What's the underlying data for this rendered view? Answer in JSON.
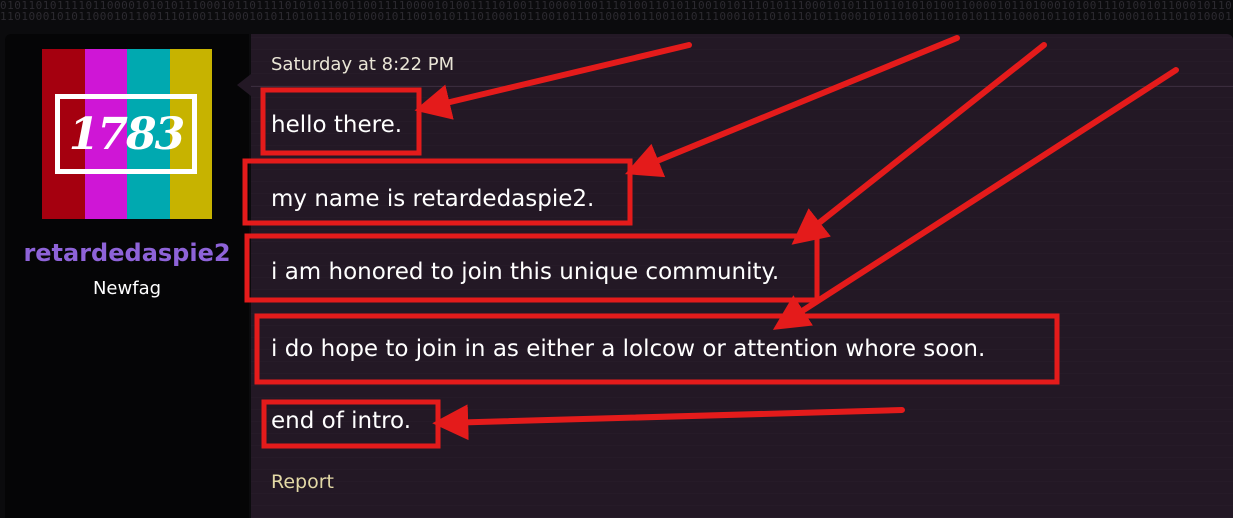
{
  "header": {
    "binary_rows": [
      "0101101011110110000101010111000101101111010101100110011110000101001111010011100001001110100110101100101011101011100010101110110101010011000010110100010100111010010110001011011010011101010101110101",
      "1101000101011000101100111010011100010101101011101010001011001010111010001011001011101000101100101011100010110101101011000101011001011010101110100010110101101000101110101000101101001011101010010110"
    ]
  },
  "user": {
    "avatar_text": "1783",
    "avatar_stripes": [
      "#a5000f",
      "#cf16d6",
      "#00a9b0",
      "#c7b300"
    ],
    "username": "retardedaspie2",
    "title": "Newfag"
  },
  "message": {
    "date": "Saturday at 8:22 PM",
    "lines": [
      "hello there.",
      "my name is retardedaspie2.",
      "i am honored to join this unique community.",
      "i do hope to join in as either a lolcow or attention whore soon.",
      "end of intro."
    ],
    "report_label": "Report"
  },
  "colors": {
    "annotation": "#e41b1b",
    "username": "#8e63d8",
    "report": "#e3d9a6"
  }
}
